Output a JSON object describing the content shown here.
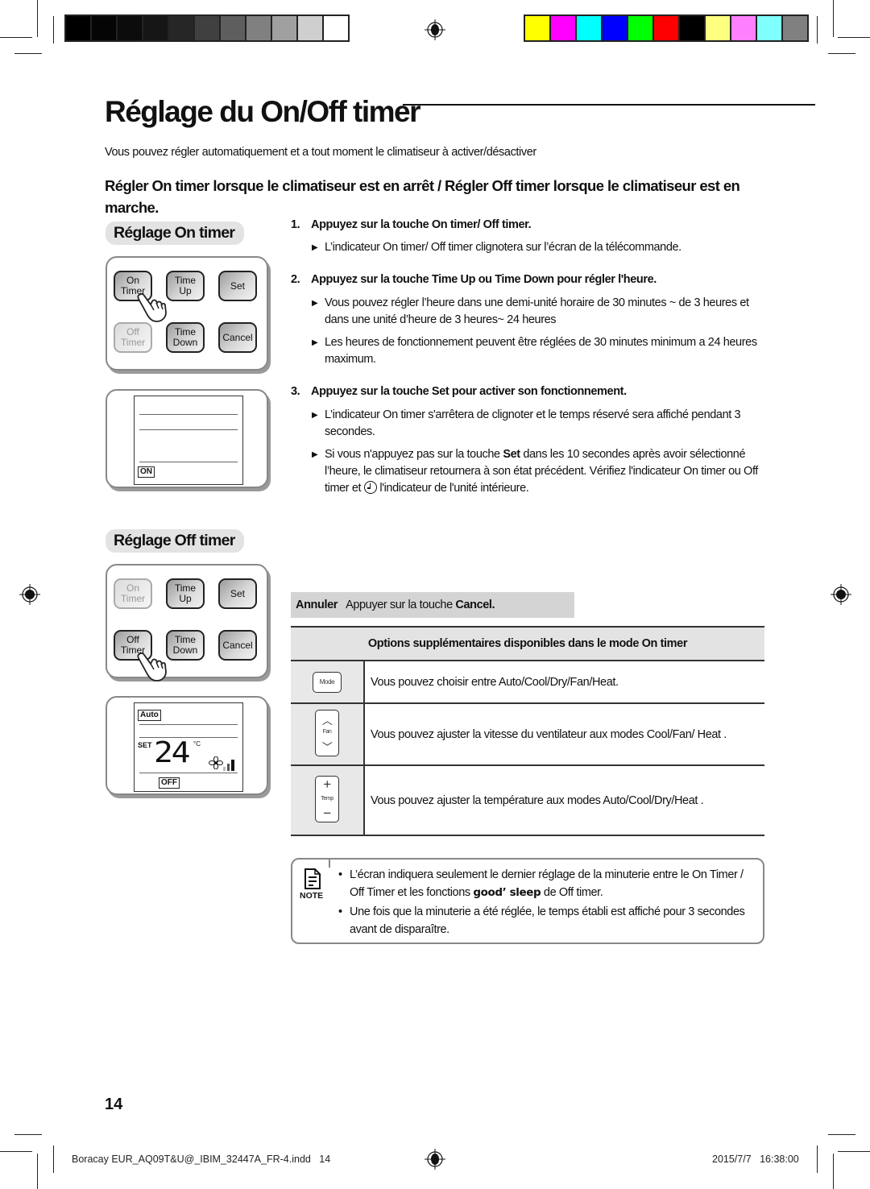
{
  "print_marks": {
    "gray_swatches": [
      "#000000",
      "#050505",
      "#0c0c0c",
      "#161616",
      "#262626",
      "#404040",
      "#5e5e5e",
      "#808080",
      "#a0a0a0",
      "#cfcfcf",
      "#ffffff"
    ],
    "color_swatches": [
      "#ffff00",
      "#ff00ff",
      "#00ffff",
      "#0000ff",
      "#00ff00",
      "#ff0000",
      "#000000",
      "#ffff80",
      "#ff80ff",
      "#80ffff",
      "#808080"
    ]
  },
  "page": {
    "title": "Réglage du On/Off timer",
    "intro": "Vous pouvez régler automatiquement et a tout moment le climatiseur à activer/désactiver",
    "subheading": "Régler On timer  lorsque le climatiseur est en arrêt / Régler Off timer lorsque le climatiseur est en marche."
  },
  "on_timer_section": {
    "label": "Réglage On timer",
    "remote_buttons": [
      {
        "line1": "On",
        "line2": "Timer",
        "state": "pressed"
      },
      {
        "line1": "Time",
        "line2": "Up",
        "state": "normal"
      },
      {
        "line1": "Set",
        "line2": "",
        "state": "normal"
      },
      {
        "line1": "Off",
        "line2": "Timer",
        "state": "disabled"
      },
      {
        "line1": "Time",
        "line2": "Down",
        "state": "normal"
      },
      {
        "line1": "Cancel",
        "line2": "",
        "state": "normal"
      }
    ],
    "display_tag": "ON"
  },
  "off_timer_section": {
    "label": "Réglage Off timer",
    "remote_buttons": [
      {
        "line1": "On",
        "line2": "Timer",
        "state": "disabled"
      },
      {
        "line1": "Time",
        "line2": "Up",
        "state": "normal"
      },
      {
        "line1": "Set",
        "line2": "",
        "state": "normal"
      },
      {
        "line1": "Off",
        "line2": "Timer",
        "state": "pressed"
      },
      {
        "line1": "Time",
        "line2": "Down",
        "state": "normal"
      },
      {
        "line1": "Cancel",
        "line2": "",
        "state": "normal"
      }
    ],
    "display": {
      "mode_tag": "Auto",
      "set_label": "SET",
      "temperature": "24",
      "unit": "°C",
      "timer_tag": "OFF"
    }
  },
  "steps": [
    {
      "number": "1.",
      "title": "Appuyez sur la touche On timer/ Off timer.",
      "bullets": [
        "L’indicateur On timer/ Off timer clignotera sur l’écran de la télécommande."
      ]
    },
    {
      "number": "2.",
      "title": "Appuyez sur la touche Time Up ou Time Down pour régler l'heure.",
      "bullets": [
        "Vous pouvez régler l’heure dans une demi-unité horaire de 30 minutes ~ de 3 heures et dans une unité d’heure de 3 heures~ 24 heures",
        "Les heures de fonctionnement peuvent être réglées de 30 minutes minimum a 24 heures maximum."
      ]
    },
    {
      "number": "3.",
      "title": "Appuyez sur la touche Set pour activer son fonctionnement.",
      "bullets": [
        "L’indicateur On timer s'arrêtera de clignoter et le temps réservé sera affiché pendant 3 secondes.",
        {
          "before_bold": "Si vous n'appuyez pas sur la touche ",
          "bold": "Set",
          "after_bold": " dans les 10 secondes après avoir sélectionné l’heure, le climatiseur retournera à son état précédent. Vérifiez l'indicateur On timer ou Off timer et ",
          "icon": "timer-clock-icon",
          "after_icon": " l'indicateur de l'unité intérieure."
        }
      ]
    }
  ],
  "cancel": {
    "label": "Annuler",
    "text": "Appuyer sur la touche ",
    "key": "Cancel."
  },
  "options_table": {
    "header": "Options supplémentaires disponibles dans le mode On timer",
    "rows": [
      {
        "icon": "mode-key-icon",
        "key_label": "Mode",
        "text": "Vous pouvez choisir entre Auto/Cool/Dry/Fan/Heat."
      },
      {
        "icon": "fan-key-icon",
        "key_label": "Fan",
        "text": "Vous pouvez ajuster la vitesse du ventilateur aux modes Cool/Fan/ Heat ."
      },
      {
        "icon": "temp-key-icon",
        "key_label": "Temp",
        "text": "Vous pouvez ajuster la température aux modes Auto/Cool/Dry/Heat ."
      }
    ]
  },
  "note": {
    "label": "NOTE",
    "items": [
      {
        "before_bold": "L’écran indiquera seulement le dernier réglage de la minuterie entre le On Timer / Off Timer et les fonctions ",
        "bold": "good’ sleep",
        "after_bold": " de Off timer."
      },
      {
        "text": "Une fois que la minuterie a été réglée, le temps établi est affiché pour 3 secondes avant de disparaître."
      }
    ]
  },
  "page_number": "14",
  "footer": {
    "file": "Boracay EUR_AQ09T&U@_IBIM_32447A_FR-4.indd   14",
    "date": "2015/7/7",
    "time": "16:38:00"
  }
}
